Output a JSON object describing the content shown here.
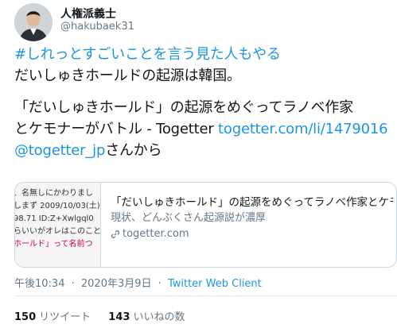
{
  "user": {
    "display_name": "人権派義士",
    "handle": "@hakubaek31"
  },
  "tweet": {
    "line1": "#しれっとすごいことを言う見た人もやる",
    "line2": "だいしゅきホールドの起源は韓国。",
    "line3": "「だいしゅきホールド」の起源をめぐってラノベ作家",
    "line4_text": "とケモナーがバトル - Togetter ",
    "line4_link": "togetter.com/li/1479016",
    "line5_mention": "@togetter_jp",
    "line5_text": "さんから"
  },
  "card": {
    "thumb_lines": [
      "、名無しにかわりまし",
      "しまず 2009/10/03(土)",
      "98.71 ID:Z+Xwlgql0",
      "らいいがオレはこのこと",
      "ホールド」って名前つ"
    ],
    "title": "「だいしゅきホールド」の起源をめぐってラノベ作家とケモ…",
    "description": "現状、どんぶくさん起源説が濃厚",
    "domain": "togetter.com"
  },
  "meta": {
    "time": "午後10:34",
    "separator": "·",
    "date": "2020年3月9日",
    "client": "Twitter Web Client"
  },
  "stats": {
    "retweets_count": "150",
    "retweets_label": "リツイート",
    "likes_count": "143",
    "likes_label": "いいねの数"
  },
  "colors": {
    "link": "#1b95e0",
    "secondary_text": "#657786",
    "border": "#ccd6dd"
  }
}
